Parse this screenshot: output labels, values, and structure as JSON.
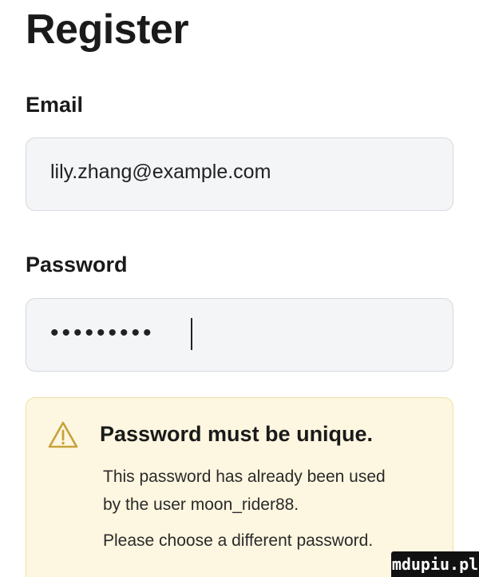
{
  "form": {
    "title": "Register",
    "email_label": "Email",
    "email_value": "lily.zhang@example.com",
    "password_label": "Password",
    "password_masked": "•••••••••"
  },
  "alert": {
    "icon": "warning-triangle-icon",
    "title": "Password must be unique.",
    "line1": "This password has already been used",
    "line2": "by the user moon_rider88.",
    "line3": "Please choose a different password."
  },
  "watermark": {
    "text": "mdupiu.pl"
  },
  "colors": {
    "field_bg": "#f4f5f7",
    "field_border": "#d6d9de",
    "alert_bg": "#fdf6e0",
    "alert_border": "#f0dfaa",
    "warning_icon": "#c8a23a"
  }
}
